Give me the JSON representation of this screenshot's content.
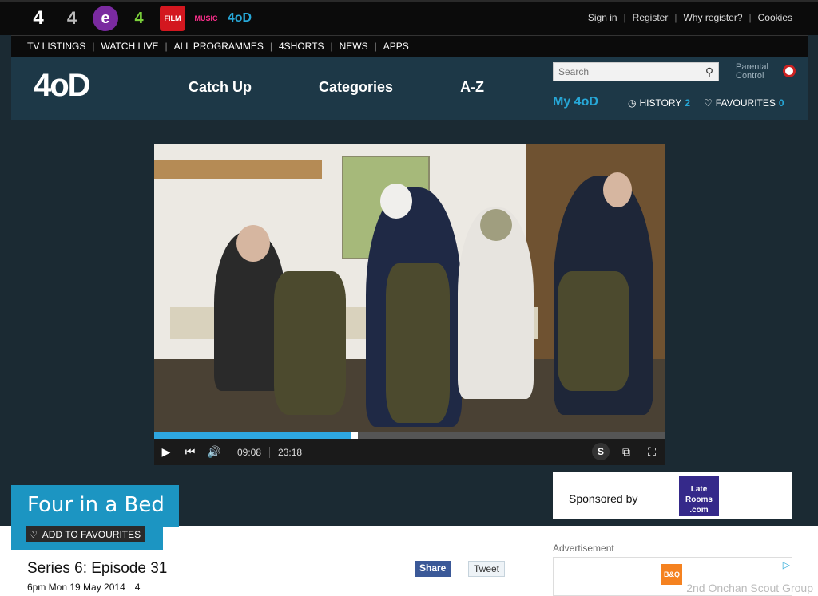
{
  "channels": [
    {
      "name": "channel-4-icon",
      "glyph": "4"
    },
    {
      "name": "4seven-icon",
      "glyph": "4"
    },
    {
      "name": "e4-icon",
      "glyph": "e"
    },
    {
      "name": "more4-icon",
      "glyph": "4"
    },
    {
      "name": "film4-icon",
      "glyph": "FILM"
    },
    {
      "name": "4music-icon",
      "glyph": "MUSIC"
    },
    {
      "name": "4od-icon",
      "glyph": "4oD"
    }
  ],
  "top_links": {
    "sign_in": "Sign in",
    "register": "Register",
    "why_register": "Why register?",
    "cookies": "Cookies"
  },
  "nav": [
    "TV LISTINGS",
    "WATCH LIVE",
    "ALL PROGRAMMES",
    "4SHORTS",
    "NEWS",
    "APPS"
  ],
  "header": {
    "logo": "4oD",
    "main_nav": [
      "Catch Up",
      "Categories",
      "A-Z"
    ],
    "search_placeholder": "Search",
    "parental_line1": "Parental",
    "parental_line2": "Control",
    "my4od": "My 4oD",
    "history_label": "HISTORY",
    "history_count": "2",
    "favourites_label": "FAVOURITES",
    "favourites_count": "0"
  },
  "player": {
    "current_time": "09:08",
    "duration": "23:18",
    "progress_fraction": 0.392,
    "subtitles_label": "S"
  },
  "sponsor": {
    "label": "Sponsored by",
    "brand_line1": "Late",
    "brand_line2": "Rooms",
    "brand_line3": ".com"
  },
  "programme": {
    "title": "Four in a Bed",
    "add_fav": "ADD TO FAVOURITES",
    "episode": "Series 6: Episode 31",
    "aired": "6pm Mon 19 May 2014",
    "channel_glyph": "4"
  },
  "social": {
    "share": "Share",
    "tweet": "Tweet"
  },
  "ad": {
    "label": "Advertisement",
    "brand": "B&Q"
  },
  "watermark": "2nd Onchan Scout Group",
  "colors": {
    "accent": "#27a8d8",
    "header_bg": "#1d3847",
    "title_bg": "#1c95c2"
  }
}
